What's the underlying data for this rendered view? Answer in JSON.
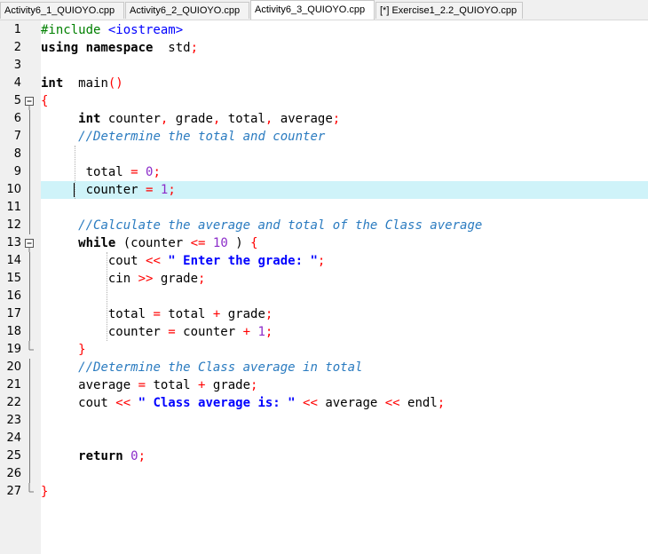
{
  "tabs": [
    {
      "label": "Activity6_1_QUIOYO.cpp",
      "active": false
    },
    {
      "label": "Activity6_2_QUIOYO.cpp",
      "active": false
    },
    {
      "label": "Activity6_3_QUIOYO.cpp",
      "active": true
    },
    {
      "label": "[*] Exercise1_2.2_QUIOYO.cpp",
      "active": false
    }
  ],
  "current_line": 10,
  "colors": {
    "keyword": "#000000",
    "preprocessor": "#008000",
    "header": "#0000ff",
    "comment": "#2a7bc0",
    "punctuation": "#ff0000",
    "number": "#8b2cc9",
    "string": "#0000ff",
    "current_line_bg": "#cff3f9"
  },
  "lines": [
    {
      "n": "1",
      "t": [
        [
          "pp",
          "#include "
        ],
        [
          "hdr",
          "<iostream>"
        ]
      ]
    },
    {
      "n": "2",
      "t": [
        [
          "k",
          "using namespace"
        ],
        [
          "",
          "  std"
        ],
        [
          "p",
          ";"
        ]
      ]
    },
    {
      "n": "3",
      "t": []
    },
    {
      "n": "4",
      "t": [
        [
          "k",
          "int"
        ],
        [
          "",
          "  main"
        ],
        [
          "p",
          "()"
        ]
      ]
    },
    {
      "n": "5",
      "t": [
        [
          "p",
          "{"
        ]
      ]
    },
    {
      "n": "6",
      "t": [
        [
          "",
          "     "
        ],
        [
          "k",
          "int"
        ],
        [
          "",
          " counter"
        ],
        [
          "p",
          ","
        ],
        [
          "",
          " grade"
        ],
        [
          "p",
          ","
        ],
        [
          "",
          " total"
        ],
        [
          "p",
          ","
        ],
        [
          "",
          " average"
        ],
        [
          "p",
          ";"
        ]
      ]
    },
    {
      "n": "7",
      "t": [
        [
          "",
          "     "
        ],
        [
          "c",
          "//Determine the total and counter"
        ]
      ]
    },
    {
      "n": "8",
      "t": []
    },
    {
      "n": "9",
      "t": [
        [
          "",
          "      total "
        ],
        [
          "p",
          "="
        ],
        [
          " ",
          ""
        ],
        [
          "n",
          " 0"
        ],
        [
          "p",
          ";"
        ]
      ]
    },
    {
      "n": "10",
      "t": [
        [
          "",
          "      counter "
        ],
        [
          "p",
          "="
        ],
        [
          "n",
          " 1"
        ],
        [
          "p",
          ";"
        ]
      ]
    },
    {
      "n": "11",
      "t": []
    },
    {
      "n": "12",
      "t": [
        [
          "",
          "     "
        ],
        [
          "c",
          "//Calculate the average and total of the Class average"
        ]
      ]
    },
    {
      "n": "13",
      "t": [
        [
          "",
          "     "
        ],
        [
          "k",
          "while"
        ],
        [
          "",
          " (counter "
        ],
        [
          "p",
          "<="
        ],
        [
          "n",
          " 10"
        ],
        [
          "",
          " ) "
        ],
        [
          "p",
          "{"
        ]
      ]
    },
    {
      "n": "14",
      "t": [
        [
          "",
          "         cout "
        ],
        [
          "p",
          "<<"
        ],
        [
          "s",
          " \" Enter the grade: \""
        ],
        [
          "p",
          ";"
        ]
      ]
    },
    {
      "n": "15",
      "t": [
        [
          "",
          "         cin "
        ],
        [
          "p",
          ">>"
        ],
        [
          "",
          " grade"
        ],
        [
          "p",
          ";"
        ]
      ]
    },
    {
      "n": "16",
      "t": []
    },
    {
      "n": "17",
      "t": [
        [
          "",
          "         total "
        ],
        [
          "p",
          "="
        ],
        [
          "",
          " total "
        ],
        [
          "p",
          "+"
        ],
        [
          "",
          " grade"
        ],
        [
          "p",
          ";"
        ]
      ]
    },
    {
      "n": "18",
      "t": [
        [
          "",
          "         counter "
        ],
        [
          "p",
          "="
        ],
        [
          "",
          " counter "
        ],
        [
          "p",
          "+"
        ],
        [
          "n",
          " 1"
        ],
        [
          "p",
          ";"
        ]
      ]
    },
    {
      "n": "19",
      "t": [
        [
          "",
          "     "
        ],
        [
          "p",
          "}"
        ]
      ]
    },
    {
      "n": "20",
      "t": [
        [
          "",
          "     "
        ],
        [
          "c",
          "//Determine the Class average in total"
        ]
      ]
    },
    {
      "n": "21",
      "t": [
        [
          "",
          "     average "
        ],
        [
          "p",
          "="
        ],
        [
          "",
          " total "
        ],
        [
          "p",
          "+"
        ],
        [
          "",
          " grade"
        ],
        [
          "p",
          ";"
        ]
      ]
    },
    {
      "n": "22",
      "t": [
        [
          "",
          "     cout "
        ],
        [
          "p",
          "<<"
        ],
        [
          "s",
          " \" Class average is: \""
        ],
        [
          "",
          " "
        ],
        [
          "p",
          "<<"
        ],
        [
          "",
          " average "
        ],
        [
          "p",
          "<<"
        ],
        [
          "",
          " endl"
        ],
        [
          "p",
          ";"
        ]
      ]
    },
    {
      "n": "23",
      "t": []
    },
    {
      "n": "24",
      "t": []
    },
    {
      "n": "25",
      "t": [
        [
          "",
          "     "
        ],
        [
          "k",
          "return"
        ],
        [
          "n",
          " 0"
        ],
        [
          "p",
          ";"
        ]
      ]
    },
    {
      "n": "26",
      "t": []
    },
    {
      "n": "27",
      "t": [
        [
          "p",
          "}"
        ]
      ]
    }
  ],
  "fold_markers": [
    {
      "line": "5",
      "type": "minus-icon"
    },
    {
      "line": "13",
      "type": "minus-icon"
    },
    {
      "line": "19",
      "type": "end-icon"
    },
    {
      "line": "27",
      "type": "end-icon"
    }
  ]
}
